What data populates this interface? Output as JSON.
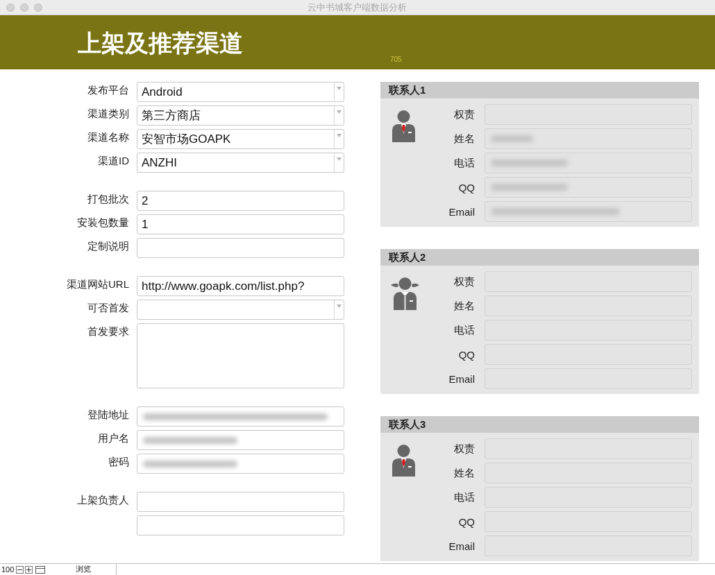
{
  "window": {
    "title": "云中书城客户端数据分析"
  },
  "header": {
    "title": "上架及推荐渠道",
    "badge": "705"
  },
  "form_groups": [
    [
      {
        "kind": "select",
        "label": "发布平台",
        "value": "Android"
      },
      {
        "kind": "select",
        "label": "渠道类别",
        "value": "第三方商店"
      },
      {
        "kind": "select",
        "label": "渠道名称",
        "value": "安智市场GOAPK"
      },
      {
        "kind": "select",
        "label": "渠道ID",
        "value": "ANZHI"
      }
    ],
    [
      {
        "kind": "text",
        "label": "打包批次",
        "value": "2"
      },
      {
        "kind": "text",
        "label": "安装包数量",
        "value": "1"
      },
      {
        "kind": "text",
        "label": "定制说明"
      }
    ],
    [
      {
        "kind": "text",
        "label": "渠道网站URL",
        "value": "http://www.goapk.com/list.php?"
      },
      {
        "kind": "select",
        "label": "可否首发"
      },
      {
        "kind": "textarea",
        "label": "首发要求"
      }
    ],
    [
      {
        "kind": "text",
        "label": "登陆地址",
        "blurred": true
      },
      {
        "kind": "text",
        "label": "用户名",
        "blurred": true
      },
      {
        "kind": "text",
        "label": "密码",
        "blurred": true
      }
    ],
    [
      {
        "kind": "text",
        "label": "上架负责人"
      },
      {
        "kind": "text"
      }
    ]
  ],
  "contacts": [
    {
      "title": "联系人1",
      "kind": "male",
      "fields": [
        {
          "label": "权责"
        },
        {
          "label": "姓名",
          "blurred": true
        },
        {
          "label": "电话",
          "blurred": true
        },
        {
          "label": "QQ",
          "blurred": true
        },
        {
          "label": "Email",
          "blurred": true
        }
      ]
    },
    {
      "title": "联系人2",
      "kind": "female",
      "fields": [
        {
          "label": "权责"
        },
        {
          "label": "姓名"
        },
        {
          "label": "电话"
        },
        {
          "label": "QQ"
        },
        {
          "label": "Email"
        }
      ]
    },
    {
      "title": "联系人3",
      "kind": "male",
      "fields": [
        {
          "label": "权责"
        },
        {
          "label": "姓名"
        },
        {
          "label": "电话"
        },
        {
          "label": "QQ"
        },
        {
          "label": "Email"
        }
      ]
    }
  ],
  "status_bar": {
    "zoom": "100",
    "mode": "浏览"
  }
}
